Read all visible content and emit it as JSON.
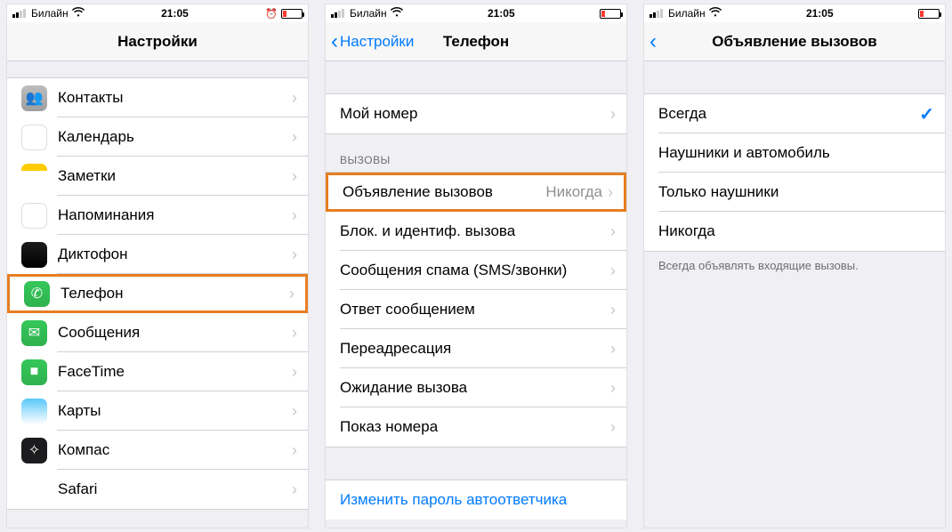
{
  "statusbar": {
    "carrier": "Билайн",
    "time": "21:05"
  },
  "screen1": {
    "title": "Настройки",
    "rows": [
      {
        "icon": "contacts",
        "label": "Контакты",
        "ic_glyph": "👥"
      },
      {
        "icon": "calendar",
        "label": "Календарь",
        "ic_glyph": ""
      },
      {
        "icon": "notes",
        "label": "Заметки",
        "ic_glyph": ""
      },
      {
        "icon": "reminders",
        "label": "Напоминания",
        "ic_glyph": ""
      },
      {
        "icon": "voice",
        "label": "Диктофон",
        "ic_glyph": ""
      },
      {
        "icon": "phone",
        "label": "Телефон",
        "ic_glyph": "✆",
        "highlight": true
      },
      {
        "icon": "messages",
        "label": "Сообщения",
        "ic_glyph": "✉︎"
      },
      {
        "icon": "facetime",
        "label": "FaceTime",
        "ic_glyph": "■"
      },
      {
        "icon": "maps",
        "label": "Карты",
        "ic_glyph": ""
      },
      {
        "icon": "compass",
        "label": "Компас",
        "ic_glyph": "✧"
      },
      {
        "icon": "safari",
        "label": "Safari",
        "ic_glyph": "✹"
      }
    ]
  },
  "screen2": {
    "back": "Настройки",
    "title": "Телефон",
    "my_number": "Мой номер",
    "calls_header": "ВЫЗОВЫ",
    "rows": [
      {
        "label": "Объявление вызовов",
        "detail": "Никогда",
        "highlight": true
      },
      {
        "label": "Блок. и идентиф. вызова"
      },
      {
        "label": "Сообщения спама (SMS/звонки)"
      },
      {
        "label": "Ответ сообщением"
      },
      {
        "label": "Переадресация"
      },
      {
        "label": "Ожидание вызова"
      },
      {
        "label": "Показ номера"
      }
    ],
    "voicemail_link": "Изменить пароль автоответчика"
  },
  "screen3": {
    "title": "Объявление вызовов",
    "options": [
      {
        "label": "Всегда",
        "selected": true
      },
      {
        "label": "Наушники и автомобиль"
      },
      {
        "label": "Только наушники"
      },
      {
        "label": "Никогда"
      }
    ],
    "footer": "Всегда объявлять входящие вызовы."
  }
}
